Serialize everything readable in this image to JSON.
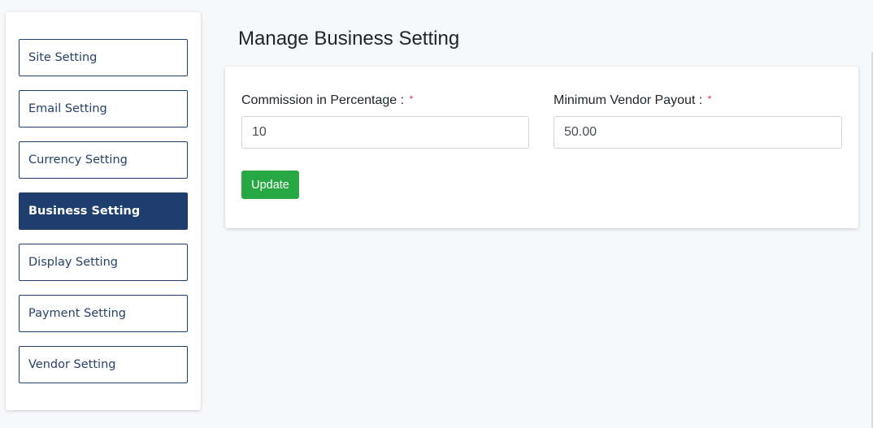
{
  "sidebar": {
    "items": [
      {
        "label": "Site Setting"
      },
      {
        "label": "Email Setting"
      },
      {
        "label": "Currency Setting"
      },
      {
        "label": "Business Setting",
        "active": true
      },
      {
        "label": "Display Setting"
      },
      {
        "label": "Payment Setting"
      },
      {
        "label": "Vendor Setting"
      }
    ]
  },
  "main": {
    "title": "Manage Business Setting",
    "form": {
      "commission": {
        "label": "Commission in Percentage :",
        "required_mark": "*",
        "value": "10"
      },
      "min_payout": {
        "label": "Minimum Vendor Payout :",
        "required_mark": "*",
        "value": "50.00"
      },
      "submit_label": "Update"
    }
  },
  "colors": {
    "sidebar_active_bg": "#1e3f6e",
    "sidebar_text": "#26426b",
    "button_success": "#28a745",
    "required": "#dc3545",
    "page_bg": "#f7f8fa"
  }
}
